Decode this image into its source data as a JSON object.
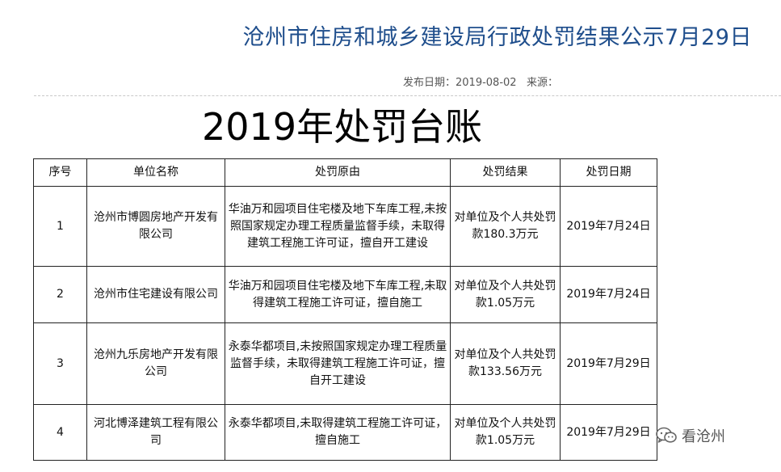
{
  "header": {
    "title": "沧州市住房和城乡建设局行政处罚结果公示7月29日",
    "publish_label": "发布日期：",
    "publish_date": "2019-08-02",
    "source_label": "来源："
  },
  "ledger_title": "2019年处罚台账",
  "table": {
    "headers": [
      "序号",
      "单位名称",
      "处罚原由",
      "处罚结果",
      "处罚日期"
    ],
    "rows": [
      {
        "no": "1",
        "company": "沧州市博圆房地产开发有限公司",
        "reason": "华油万和园项目住宅楼及地下车库工程,未按照国家规定办理工程质量监督手续，未取得建筑工程施工许可证，擅自开工建设",
        "result": "对单位及个人共处罚款180.3万元",
        "date": "2019年7月24日"
      },
      {
        "no": "2",
        "company": "沧州市住宅建设有限公司",
        "reason": "华油万和园项目住宅楼及地下车库工程,未取得建筑工程施工许可证，擅自施工",
        "result": "对单位及个人共处罚款1.05万元",
        "date": "2019年7月24日"
      },
      {
        "no": "3",
        "company": "沧州九乐房地产开发有限公司",
        "reason": "永泰华都项目,未按照国家规定办理工程质量监督手续，未取得建筑工程施工许可证，擅自开工建设",
        "result": "对单位及个人共处罚款133.56万元",
        "date": "2019年7月29日"
      },
      {
        "no": "4",
        "company": "河北博泽建筑工程有限公司",
        "reason": "永泰华都项目,未取得建筑工程施工许可证，擅自施工",
        "result": "对单位及个人共处罚款1.05万元",
        "date": "2019年7月29日"
      }
    ]
  },
  "watermark": {
    "icon": "wechat-icon",
    "text": "看沧州"
  }
}
